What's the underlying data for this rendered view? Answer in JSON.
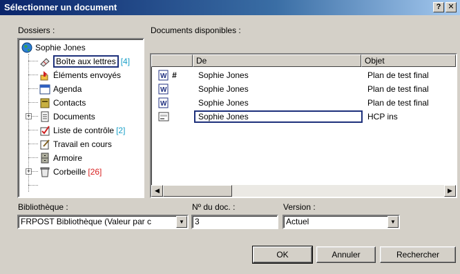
{
  "window": {
    "title": "Sélectionner un document",
    "help_label": "?",
    "close_label": "✕"
  },
  "folders": {
    "label": "Dossiers :",
    "items": [
      {
        "label": "Sophie Jones",
        "icon": "globe-icon"
      },
      {
        "label": "Boîte aux lettres",
        "count": "[4]",
        "icon": "mailbox-icon"
      },
      {
        "label": "Éléments envoyés",
        "icon": "sent-items-icon"
      },
      {
        "label": "Agenda",
        "icon": "calendar-icon"
      },
      {
        "label": "Contacts",
        "icon": "contacts-icon"
      },
      {
        "label": "Documents",
        "icon": "documents-icon"
      },
      {
        "label": "Liste de contrôle",
        "count": "[2]",
        "icon": "checklist-icon"
      },
      {
        "label": "Travail en cours",
        "icon": "work-in-progress-icon"
      },
      {
        "label": "Armoire",
        "icon": "cabinet-icon"
      },
      {
        "label": "Corbeille",
        "count": "[26]",
        "icon": "trash-icon"
      }
    ],
    "expand_label": "+"
  },
  "documents": {
    "label": "Documents disponibles :",
    "columns": [
      "De",
      "Objet"
    ],
    "rows": [
      {
        "icon": "word-document-icon",
        "marker": "#",
        "from": "Sophie Jones",
        "subject": "Plan de test final"
      },
      {
        "icon": "word-document-icon",
        "marker": "",
        "from": "Sophie Jones",
        "subject": "Plan de test final"
      },
      {
        "icon": "word-document-icon",
        "marker": "",
        "from": "Sophie Jones",
        "subject": "Plan de test final"
      },
      {
        "icon": "form-document-icon",
        "marker": "",
        "from": "Sophie Jones",
        "subject": "HCP ins"
      }
    ]
  },
  "library": {
    "label": "Bibliothèque :",
    "value": "FRPOST Bibliothèque  (Valeur par c"
  },
  "docnum": {
    "label": "Nº du doc. :",
    "value": "3"
  },
  "version": {
    "label": "Version :",
    "value": "Actuel"
  },
  "buttons": {
    "ok": "OK",
    "cancel": "Annuler",
    "search": "Rechercher"
  }
}
